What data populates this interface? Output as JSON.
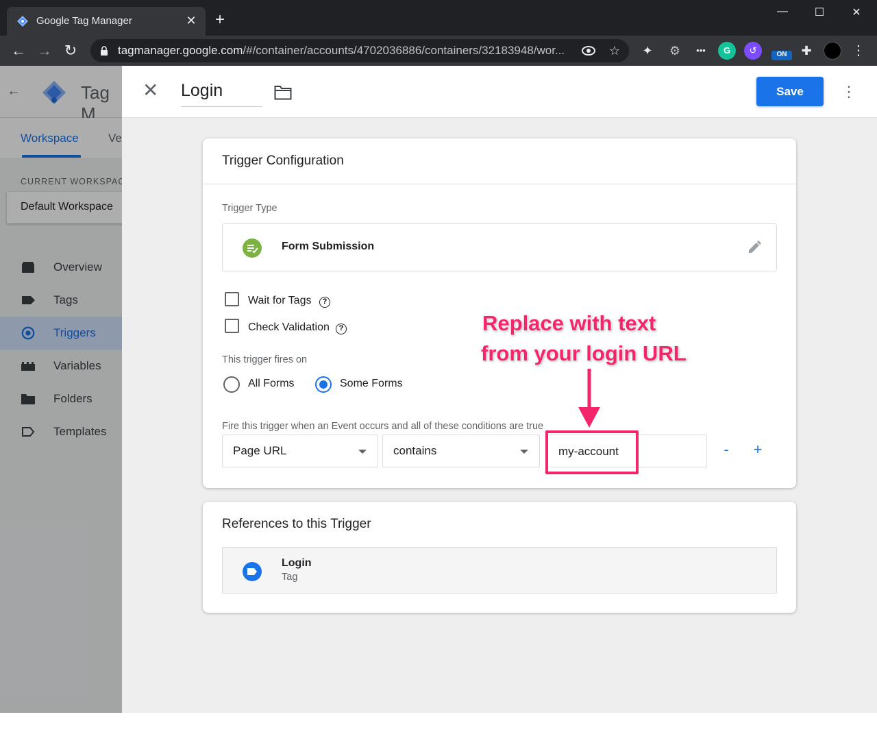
{
  "browser": {
    "tab_title": "Google Tag Manager",
    "tab_close": "✕",
    "new_tab": "+",
    "url_host": "tagmanager.google.com",
    "url_path": "/#/container/accounts/4702036886/containers/32183948/wor...",
    "window_controls": {
      "minimize": "—",
      "maximize": "☐",
      "close": "✕"
    },
    "nav": {
      "back": "←",
      "forward": "→",
      "reload": "↻"
    },
    "extensions": [
      "puzzle-icon",
      "gear-icon",
      "dots-icon",
      "grammarly-icon",
      "dashlane-icon",
      "on-icon",
      "extensions-icon",
      "profile-avatar",
      "menu-icon"
    ],
    "ext_on_label": "ON",
    "ext_g_label": "G"
  },
  "gtm": {
    "app_name": "Tag M",
    "tabs": [
      "Workspace",
      "Ve"
    ],
    "current_workspace_label": "CURRENT WORKSPAC",
    "workspace_name": "Default Workspace",
    "nav_items": [
      {
        "label": "Overview",
        "icon": "overview-icon"
      },
      {
        "label": "Tags",
        "icon": "tag-icon"
      },
      {
        "label": "Triggers",
        "icon": "trigger-icon",
        "active": true
      },
      {
        "label": "Variables",
        "icon": "variables-icon"
      },
      {
        "label": "Folders",
        "icon": "folder-icon"
      },
      {
        "label": "Templates",
        "icon": "template-icon"
      }
    ]
  },
  "panel": {
    "close_label": "✕",
    "trigger_name": "Login",
    "save_label": "Save",
    "more_label": "⋮"
  },
  "config": {
    "title": "Trigger Configuration",
    "trigger_type_label": "Trigger Type",
    "trigger_type": "Form Submission",
    "wait_for_tags": {
      "label": "Wait for Tags",
      "checked": false
    },
    "check_validation": {
      "label": "Check Validation",
      "checked": false
    },
    "fires_on_label": "This trigger fires on",
    "fires_on_options": [
      "All Forms",
      "Some Forms"
    ],
    "fires_on_selected": "Some Forms",
    "conditions_label": "Fire this trigger when an Event occurs and all of these conditions are true",
    "condition": {
      "variable": "Page URL",
      "operator": "contains",
      "value": "my-account"
    },
    "minus_label": "-",
    "plus_label": "+"
  },
  "references": {
    "title": "References to this Trigger",
    "items": [
      {
        "name": "Login",
        "type": "Tag"
      }
    ]
  },
  "annotation": {
    "line1": "Replace with text",
    "line2": "from your login URL",
    "color": "#f3256b"
  },
  "colors": {
    "accent": "#1a73e8",
    "form_submission_icon": "#7cb342",
    "annotation": "#f3256b"
  }
}
